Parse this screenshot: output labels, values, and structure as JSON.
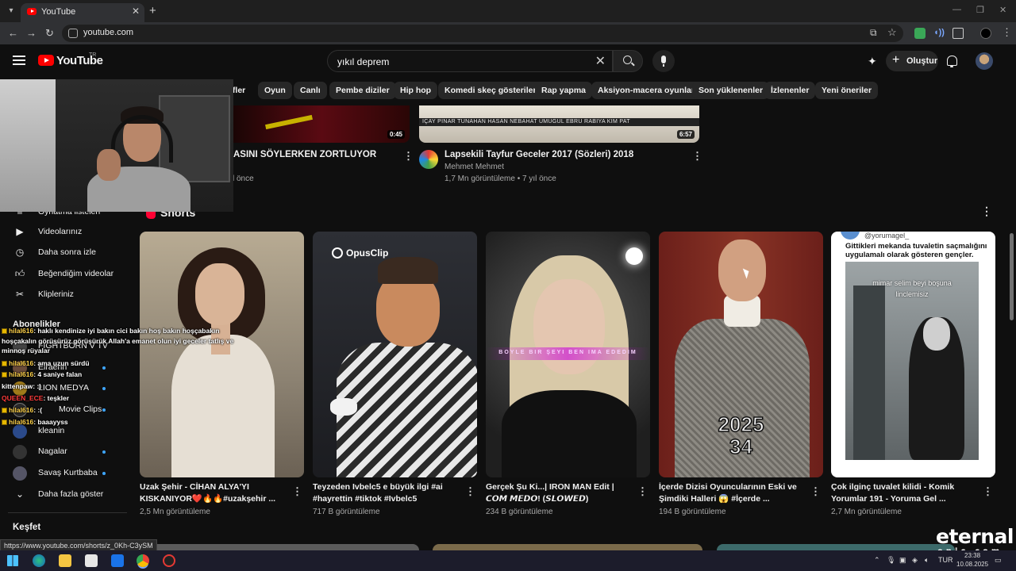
{
  "browser": {
    "tab_title": "YouTube",
    "url": "youtube.com"
  },
  "header": {
    "logo_text": "YouTube",
    "logo_region": "TR",
    "search_value": "yıkıl deprem",
    "create_label": "Oluştur"
  },
  "chips": [
    {
      "label": "ifler"
    },
    {
      "label": "Oyun"
    },
    {
      "label": "Canlı"
    },
    {
      "label": "Pembe diziler"
    },
    {
      "label": "Hip hop"
    },
    {
      "label": "Komedi skeç gösterileri"
    },
    {
      "label": "Rap yapma"
    },
    {
      "label": "Aksiyon-macera oyunları"
    },
    {
      "label": "Son yüklenenler"
    },
    {
      "label": "İzlenenler"
    },
    {
      "label": "Yeni öneriler"
    }
  ],
  "top_videos": [
    {
      "title": "ASINI SÖYLERKEN  ZORTLUYOR",
      "meta": "l önce",
      "duration": "0:45"
    },
    {
      "title": "Lapsekili Tayfur Geceler 2017 (Sözleri) 2018",
      "channel": "Mehmet Mehmet",
      "meta": "1,7 Mn görüntüleme • 7 yıl önce",
      "duration": "6:57",
      "thumb_text": "IÇAY PINAR TUNAHAN HASAN NEBAHAT UMUGUL EBRU RABIYA KIM PAT"
    }
  ],
  "sidebar": {
    "partial_item": "Oynatma listeleri",
    "items": [
      {
        "label": "Videolarınız",
        "icon": "play-square-icon"
      },
      {
        "label": "Daha sonra izle",
        "icon": "clock-icon"
      },
      {
        "label": "Beğendiğim videolar",
        "icon": "thumbs-up-icon"
      },
      {
        "label": "Klipleriniz",
        "icon": "scissors-icon"
      }
    ],
    "subs_heading": "Abonelikler",
    "subscriptions": [
      {
        "label": "FIGHTBORN V TV"
      },
      {
        "label": "Eiraenn"
      },
      {
        "label": "LION MEDYA"
      },
      {
        "label": "Movie Clips"
      },
      {
        "label": "kleanin"
      },
      {
        "label": "Nagalar"
      },
      {
        "label": "Savaş Kurtbaba"
      }
    ],
    "more_label": "Daha fazla göster",
    "explore_label": "Keşfet"
  },
  "shorts": {
    "heading": "Shorts",
    "items": [
      {
        "title": "Uzak Şehir - CİHAN ALYA'YI KISKANIYOR❤️🔥🔥#uzakşehir ...",
        "views": "2,5 Mn görüntüleme"
      },
      {
        "title": "Teyzeden Ivbelc5 e büyük ilgi #ai #hayrettin #tiktok #Ivbelc5",
        "views": "717 B görüntüleme",
        "overlay": "OpusClip"
      },
      {
        "title": "Gerçek Şu Ki...| IRON MAN Edit |𝘾𝙊𝙈 𝙈𝙀𝘿𝙊! (𝙎𝙇𝙊𝙒𝙀𝘿)",
        "views": "234 B görüntüleme",
        "overlay": "BOYLE BIR ŞEYI BEN IMA EDEDIM"
      },
      {
        "title": "İçerde Dizisi Oyuncularının Eski ve Şimdiki Halleri 😱 #İçerde ...",
        "views": "194 B görüntüleme",
        "overlay_top": "2025",
        "overlay_bottom": "34"
      },
      {
        "title": "Çok ilginç tuvalet kilidi - Komik Yorumlar 191 - Yoruma Gel ...",
        "views": "2,7 Mn görüntüleme",
        "handle": "@yorumagel_",
        "caption": "Gittikleri mekanda tuvaletin saçmalığını uygulamalı olarak gösteren gençler.",
        "inner_text_1": "mimar selim beyi boşuna",
        "inner_text_2": "linclemisiz"
      }
    ]
  },
  "chat": [
    {
      "user": "hilal616",
      "text": ": haklı kendinize iyi bakın cici bakın hoş bakın hoşçabakın",
      "color": "gold"
    },
    {
      "user": "",
      "text": "hoşçakalın görüşürüz görüşürük Allah'a emanet olun iyi geceler tatlış ve",
      "color": "none"
    },
    {
      "user": "",
      "text": "minnoş rüyalar",
      "color": "none"
    },
    {
      "user": "hilal616",
      "text": ": ama uzun sürdü",
      "color": "gold"
    },
    {
      "user": "hilal616",
      "text": ": 4 saniye falan",
      "color": "gold"
    },
    {
      "user": "kittenpaw",
      "text": ": :)",
      "color": "white"
    },
    {
      "user": "QUEEN_ECE",
      "text": ": teşkler",
      "color": "red"
    },
    {
      "user": "hilal616",
      "text": ": :(",
      "color": "gold"
    },
    {
      "user": "hilal616",
      "text": ": baaayyss",
      "color": "gold"
    }
  ],
  "status_url": "https://www.youtube.com/shorts/z_0Kh-C3ySM",
  "taskbar": {
    "lang": "TUR",
    "time": "23:38",
    "date": "10.08.2025"
  },
  "watermark": {
    "line1": "eternal",
    "line2": "epic.com"
  }
}
